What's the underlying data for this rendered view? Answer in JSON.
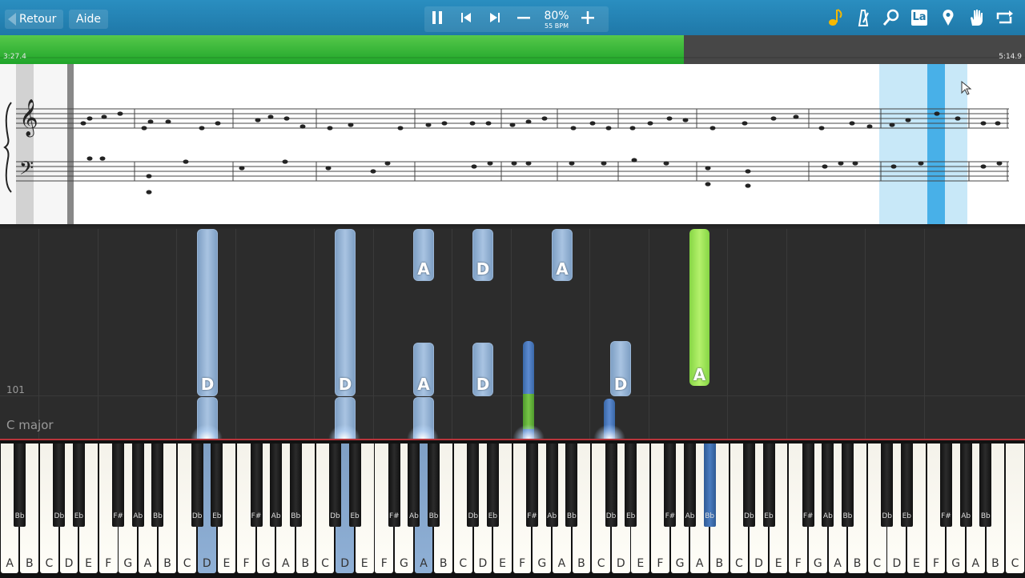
{
  "toolbar": {
    "back_label": "Retour",
    "help_label": "Aide",
    "speed_percent": "80%",
    "speed_bpm": "55 BPM",
    "language_label": "La"
  },
  "progress": {
    "current_time": "3:27.4",
    "total_time": "5:14.9",
    "fraction": 0.667
  },
  "falling": {
    "measure_number": "101",
    "key_signature": "C major",
    "notes": [
      {
        "label": "D",
        "color": "blue"
      },
      {
        "label": "D",
        "color": "blue"
      },
      {
        "label": "A",
        "color": "blue"
      },
      {
        "label": "A",
        "color": "blue"
      },
      {
        "label": "D",
        "color": "blue"
      },
      {
        "label": "D",
        "color": "blue"
      },
      {
        "label": "A",
        "color": "blue"
      },
      {
        "label": "D",
        "color": "blue"
      },
      {
        "label": "A",
        "color": "green"
      }
    ]
  },
  "keyboard": {
    "white_keys": [
      "A",
      "B",
      "C",
      "D",
      "E",
      "F",
      "G",
      "A",
      "B",
      "C",
      "D",
      "E",
      "F",
      "G",
      "A",
      "B",
      "C",
      "D",
      "E",
      "F",
      "G",
      "A",
      "B",
      "C",
      "D",
      "E",
      "F",
      "G",
      "A",
      "B",
      "C",
      "D",
      "E",
      "F",
      "G",
      "A",
      "B",
      "C",
      "D",
      "E",
      "F",
      "G",
      "A",
      "B",
      "C",
      "D",
      "E",
      "F",
      "G",
      "A",
      "B",
      "C"
    ],
    "black_keys": [
      "Bb",
      "Db",
      "Eb",
      "F#",
      "Ab",
      "Bb",
      "Db",
      "Eb",
      "F#",
      "Ab",
      "Bb",
      "Db",
      "Eb",
      "F#",
      "Ab",
      "Bb",
      "Db",
      "Eb",
      "F#",
      "Ab",
      "Bb",
      "Db",
      "Eb",
      "F#",
      "Ab",
      "Bb",
      "Db",
      "Eb",
      "F#",
      "Ab",
      "Bb",
      "Db",
      "Eb",
      "F#",
      "Ab",
      "Bb"
    ]
  },
  "colors": {
    "toolbar": "#2a8ec0",
    "progress_fill": "#1fa52a",
    "note_blue": "#a9c4e2",
    "note_green": "#b4f06c",
    "highlight": "#c8e8f8",
    "cursor": "#48b0e8"
  }
}
